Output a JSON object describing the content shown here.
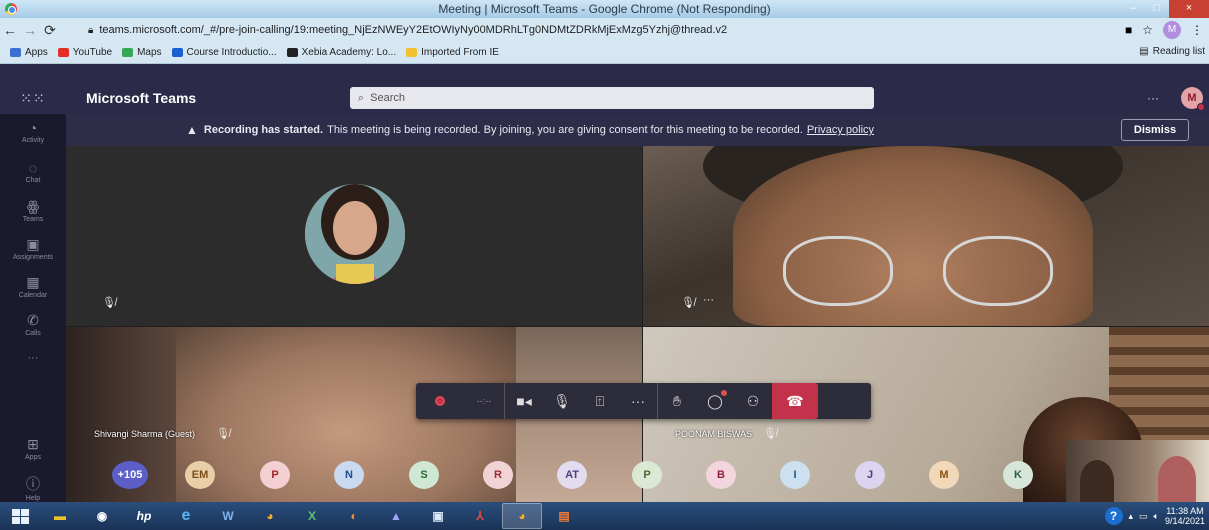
{
  "window": {
    "title": "Meeting | Microsoft Teams - Google Chrome (Not Responding)",
    "minimize": "–",
    "maximize": "□",
    "close": "×"
  },
  "browser": {
    "url": "teams.microsoft.com/_#/pre-join-calling/19:meeting_NjEzNWEyY2EtOWIyNy00MDRhLTg0NDMtZDRkMjExMzg5Yzhj@thread.v2",
    "profile_initial": "M",
    "bookmarks": [
      {
        "label": "Apps",
        "color": "#3b6fd1"
      },
      {
        "label": "YouTube",
        "color": "#e52d27"
      },
      {
        "label": "Maps",
        "color": "#34a853"
      },
      {
        "label": "Course Introductio...",
        "color": "#1a5fd1"
      },
      {
        "label": "Xebia Academy: Lo...",
        "color": "#222222"
      },
      {
        "label": "Imported From IE",
        "color": "#f2c12e"
      }
    ],
    "reading_list": "Reading list"
  },
  "teams": {
    "app_name": "Microsoft Teams",
    "search_placeholder": "Search",
    "more": "···",
    "user_initial": "M",
    "rail": [
      {
        "label": "Activity",
        "icon": "bell-icon"
      },
      {
        "label": "Chat",
        "icon": "chat-icon"
      },
      {
        "label": "Teams",
        "icon": "teams-icon"
      },
      {
        "label": "Assignments",
        "icon": "assignments-icon"
      },
      {
        "label": "Calendar",
        "icon": "calendar-icon"
      },
      {
        "label": "Calls",
        "icon": "phone-icon"
      },
      {
        "label": "···",
        "icon": "more-icon"
      },
      {
        "label": "Apps",
        "icon": "apps-icon"
      },
      {
        "label": "Help",
        "icon": "help-icon"
      }
    ]
  },
  "banner": {
    "bold": "Recording has started.",
    "text": "This meeting is being recorded. By joining, you are giving consent for this meeting to be recorded.",
    "link": "Privacy policy",
    "dismiss": "Dismiss"
  },
  "tiles": {
    "c_name": "Shivangi Sharma (Guest)",
    "d_name": "POONAM BISWAS",
    "b_more": "···"
  },
  "callbar": {
    "timer": "--:--"
  },
  "participants": [
    "+105",
    "EM",
    "P",
    "N",
    "S",
    "R",
    "AT",
    "P",
    "B",
    "I",
    "J",
    "M",
    "K"
  ],
  "taskbar": {
    "help": "?",
    "time": "11:38 AM",
    "date": "9/14/2021"
  }
}
